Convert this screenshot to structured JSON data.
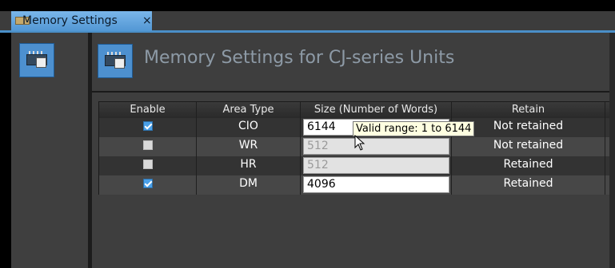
{
  "tab": {
    "title": "Memory Settings",
    "close": "×"
  },
  "page": {
    "title": "Memory Settings for CJ-series Units"
  },
  "table": {
    "headers": [
      "Enable",
      "Area Type",
      "Size (Number of Words)",
      "Retain"
    ],
    "rows": [
      {
        "enabled": true,
        "area": "CIO",
        "size": "6144",
        "retain": "Not retained"
      },
      {
        "enabled": false,
        "area": "WR",
        "size": "512",
        "retain": "Not retained"
      },
      {
        "enabled": false,
        "area": "HR",
        "size": "512",
        "retain": "Retained"
      },
      {
        "enabled": true,
        "area": "DM",
        "size": "4096",
        "retain": "Retained"
      }
    ]
  },
  "tooltip": "Valid range: 1 to 6144",
  "icons": {
    "tab": "memory-chip-icon",
    "nav": "memory-chip-icon",
    "header": "memory-chip-icon",
    "close": "close-icon",
    "cursor": "mouse-pointer-icon"
  },
  "colors": {
    "accent": "#4a8fc8",
    "tab_bg": "#5a9fd9",
    "checked": "#4aa0e8"
  }
}
